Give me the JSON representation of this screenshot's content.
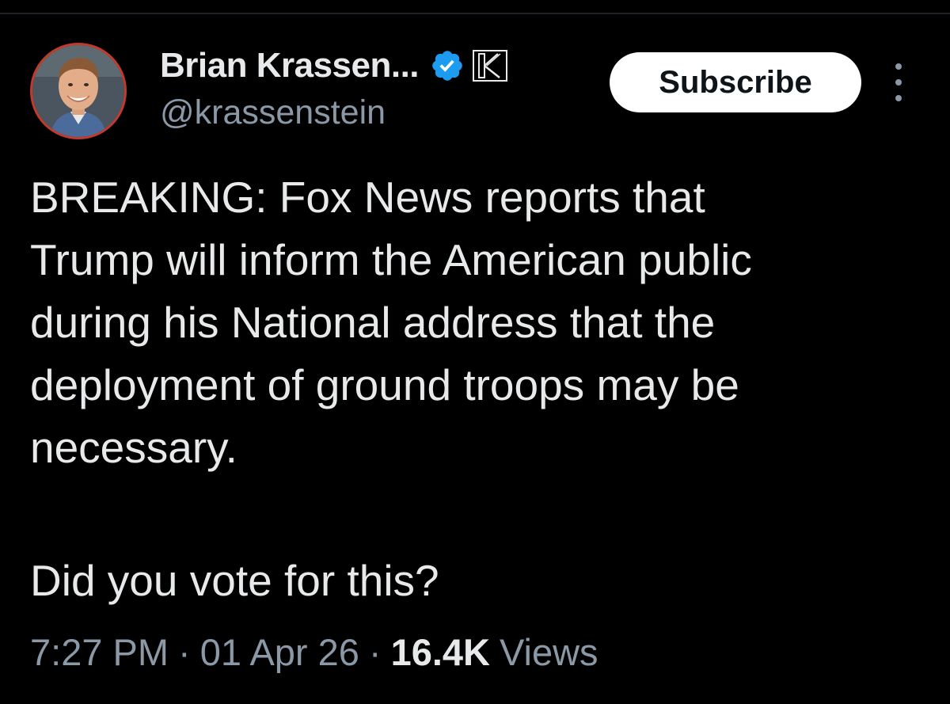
{
  "author": {
    "display_name": "Brian Krassen...",
    "handle": "@krassenstein",
    "verified_icon": "verified-badge-icon",
    "affiliate_icon": "k-affiliate-badge-icon",
    "avatar_border_color": "#c23a2b"
  },
  "actions": {
    "subscribe_label": "Subscribe",
    "more_icon": "more-vertical-icon"
  },
  "tweet": {
    "text": "BREAKING: Fox News reports that\nTrump will inform the American public\nduring his National address that the\ndeployment of ground troops may be\nnecessary.",
    "question": "Did you vote for this?"
  },
  "meta": {
    "time": "7:27 PM",
    "separator": "·",
    "date": "01 Apr 26",
    "views_count": "16.4K",
    "views_label": "Views"
  },
  "colors": {
    "background": "#000000",
    "text_primary": "#e7e9ea",
    "text_secondary": "#8b98a5",
    "verified_blue": "#1d9bf0"
  }
}
